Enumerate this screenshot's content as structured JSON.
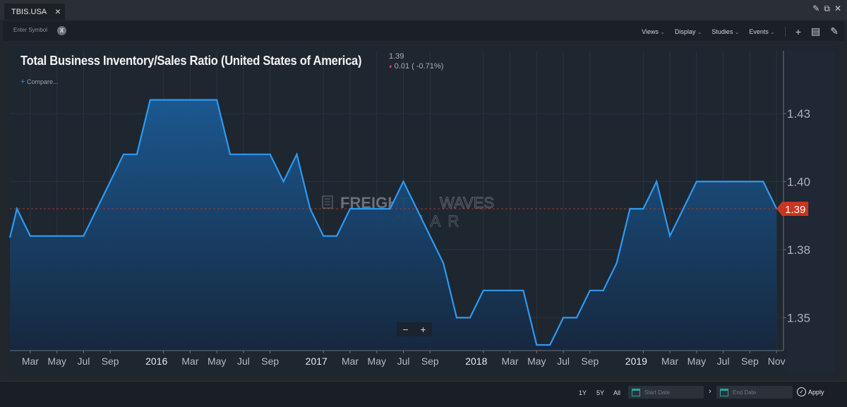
{
  "tab": {
    "name": "TBIS.USA",
    "close_icon": "×"
  },
  "window_controls": [
    {
      "name": "edit-icon",
      "glyph": "✎"
    },
    {
      "name": "popout-icon",
      "glyph": "⧉"
    },
    {
      "name": "close-icon",
      "glyph": "✕"
    }
  ],
  "toolbar": {
    "symbol_placeholder": "Enter Symbol",
    "symbol_clear": "X",
    "menus": [
      "Views",
      "Display",
      "Studies",
      "Events"
    ],
    "add_icon": "+",
    "comment_icon": "▤",
    "draw_icon": "✎"
  },
  "header": {
    "title": "Total Business Inventory/Sales Ratio (United States of America)",
    "last_value": "1.39",
    "change": "0.01 ( -0.71%)",
    "change_dot": "♦",
    "compare_plus": "+",
    "compare_label": "Compare..."
  },
  "watermark": {
    "line1a": "FREIGHT",
    "line1b": "WAVES",
    "line2": "SONAR"
  },
  "zoom_controls": {
    "minus": "−",
    "plus": "+"
  },
  "bottom": {
    "ranges": [
      "1Y",
      "5Y",
      "All"
    ],
    "start_placeholder": "Start Date",
    "end_placeholder": "End Date",
    "arrow": "›",
    "apply_label": "Apply",
    "apply_icon": "✓"
  },
  "colors": {
    "line": "#2e9af0",
    "fill_top": "#1b5a94",
    "fill_bottom": "#16283f",
    "last_badge": "#c9361f",
    "ref_line": "#c0392b"
  },
  "chart_data": {
    "type": "area",
    "title": "Total Business Inventory/Sales Ratio (United States of America)",
    "xlabel": "",
    "ylabel": "",
    "x": [
      "2015-01",
      "2015-02",
      "2015-03",
      "2015-04",
      "2015-05",
      "2015-06",
      "2015-07",
      "2015-08",
      "2015-09",
      "2015-10",
      "2015-11",
      "2015-12",
      "2016-01",
      "2016-02",
      "2016-03",
      "2016-04",
      "2016-05",
      "2016-06",
      "2016-07",
      "2016-08",
      "2016-09",
      "2016-10",
      "2016-11",
      "2016-12",
      "2017-01",
      "2017-02",
      "2017-03",
      "2017-04",
      "2017-05",
      "2017-06",
      "2017-07",
      "2017-08",
      "2017-09",
      "2017-10",
      "2017-11",
      "2017-12",
      "2018-01",
      "2018-02",
      "2018-03",
      "2018-04",
      "2018-05",
      "2018-06",
      "2018-07",
      "2018-08",
      "2018-09",
      "2018-10",
      "2018-11",
      "2018-12",
      "2019-01",
      "2019-02",
      "2019-03",
      "2019-04",
      "2019-05",
      "2019-06",
      "2019-07",
      "2019-08",
      "2019-09",
      "2019-10",
      "2019-11"
    ],
    "series": [
      {
        "name": "TBIS.USA",
        "values": [
          1.37,
          1.39,
          1.38,
          1.38,
          1.38,
          1.38,
          1.38,
          1.39,
          1.4,
          1.41,
          1.41,
          1.43,
          1.43,
          1.43,
          1.43,
          1.43,
          1.43,
          1.41,
          1.41,
          1.41,
          1.41,
          1.4,
          1.41,
          1.39,
          1.38,
          1.38,
          1.39,
          1.39,
          1.39,
          1.39,
          1.4,
          1.39,
          1.38,
          1.37,
          1.35,
          1.35,
          1.36,
          1.36,
          1.36,
          1.36,
          1.34,
          1.34,
          1.35,
          1.35,
          1.36,
          1.36,
          1.37,
          1.39,
          1.39,
          1.4,
          1.38,
          1.39,
          1.4,
          1.4,
          1.4,
          1.4,
          1.4,
          1.4,
          1.39
        ]
      }
    ],
    "y_ticks": [
      1.35,
      1.375,
      1.4,
      1.425
    ],
    "y_tick_labels": [
      "1.35",
      "1.38",
      "1.40",
      "1.43"
    ],
    "x_tick_labels": [
      {
        "date": "2015-03",
        "label": "Mar"
      },
      {
        "date": "2015-05",
        "label": "May"
      },
      {
        "date": "2015-07",
        "label": "Jul"
      },
      {
        "date": "2015-09",
        "label": "Sep"
      },
      {
        "date": "2016-01",
        "label": "2016"
      },
      {
        "date": "2016-03",
        "label": "Mar"
      },
      {
        "date": "2016-05",
        "label": "May"
      },
      {
        "date": "2016-07",
        "label": "Jul"
      },
      {
        "date": "2016-09",
        "label": "Sep"
      },
      {
        "date": "2017-01",
        "label": "2017"
      },
      {
        "date": "2017-03",
        "label": "Mar"
      },
      {
        "date": "2017-05",
        "label": "May"
      },
      {
        "date": "2017-07",
        "label": "Jul"
      },
      {
        "date": "2017-09",
        "label": "Sep"
      },
      {
        "date": "2018-01",
        "label": "2018"
      },
      {
        "date": "2018-03",
        "label": "Mar"
      },
      {
        "date": "2018-05",
        "label": "May"
      },
      {
        "date": "2018-07",
        "label": "Jul"
      },
      {
        "date": "2018-09",
        "label": "Sep"
      },
      {
        "date": "2019-01",
        "label": "2019"
      },
      {
        "date": "2019-03",
        "label": "Mar"
      },
      {
        "date": "2019-05",
        "label": "May"
      },
      {
        "date": "2019-07",
        "label": "Jul"
      },
      {
        "date": "2019-09",
        "label": "Sep"
      },
      {
        "date": "2019-11",
        "label": "Nov"
      }
    ],
    "ylim": [
      1.337,
      1.435
    ],
    "last_value_label": "1.39",
    "reference_line": 1.39,
    "grid": true,
    "legend": "none"
  }
}
